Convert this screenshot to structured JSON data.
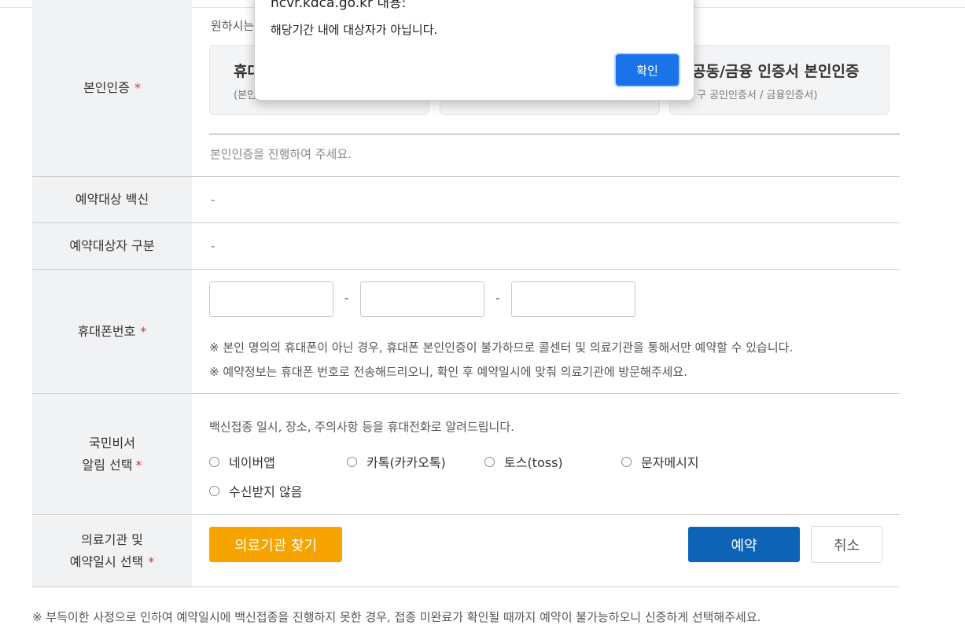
{
  "auth": {
    "label": "본인인증",
    "required_mark": "*",
    "intro": "원하시는",
    "methods": [
      {
        "title": "휴대",
        "sub": "(본인"
      },
      {
        "title": "",
        "sub": ""
      },
      {
        "title": "공동/금융 인증서 본인인증",
        "sub": "구 공인인증서 / 금융인증서)"
      }
    ],
    "message": "본인인증을 진행하여 주세요."
  },
  "vaccine": {
    "label": "예약대상 백신",
    "value": "-"
  },
  "target_type": {
    "label": "예약대상자 구분",
    "value": "-"
  },
  "phone": {
    "label": "휴대폰번호",
    "required_mark": "*",
    "fields": [
      {
        "value": ""
      },
      {
        "value": ""
      },
      {
        "value": ""
      }
    ],
    "separator": "-",
    "notes": [
      "※ 본인 명의의 휴대폰이 아닌 경우, 휴대폰 본인인증이 불가하므로 콜센터 및 의료기관을 통해서만 예약할 수 있습니다.",
      "※ 예약정보는 휴대폰 번호로 전송해드리오니, 확인 후 예약일시에 맞춰 의료기관에 방문해주세요."
    ]
  },
  "notify": {
    "label_line1": "국민비서",
    "label_line2": "알림 선택",
    "required_mark": "*",
    "description": "백신접종 일시, 장소, 주의사항 등을 휴대전화로 알려드립니다.",
    "options": [
      "네이버앱",
      "카톡(카카오톡)",
      "토스(toss)",
      "문자메시지",
      "수신받지 않음"
    ]
  },
  "hospital": {
    "label_line1": "의료기관 및",
    "label_line2": "예약일시 선택",
    "required_mark": "*",
    "find_button": "의료기관 찾기",
    "reserve_button": "예약",
    "cancel_button": "취소"
  },
  "footnote": "※ 부득이한 사정으로 인하여 예약일시에 백신접종을 진행하지 못한 경우, 접종 미완료가 확인될 때까지 예약이 불가능하오니 신중하게 선택해주세요.",
  "dialog": {
    "origin": "ncvr.kdca.go.kr 내용:",
    "message": "해당기간 내에 대상자가 아닙니다.",
    "ok_button": "확인"
  },
  "colors": {
    "header_bg": "#f1f2f4",
    "required": "#d6334a",
    "find_button": "#f7a400",
    "reserve_button": "#0d63b5",
    "dialog_ok": "#1a73e8"
  }
}
